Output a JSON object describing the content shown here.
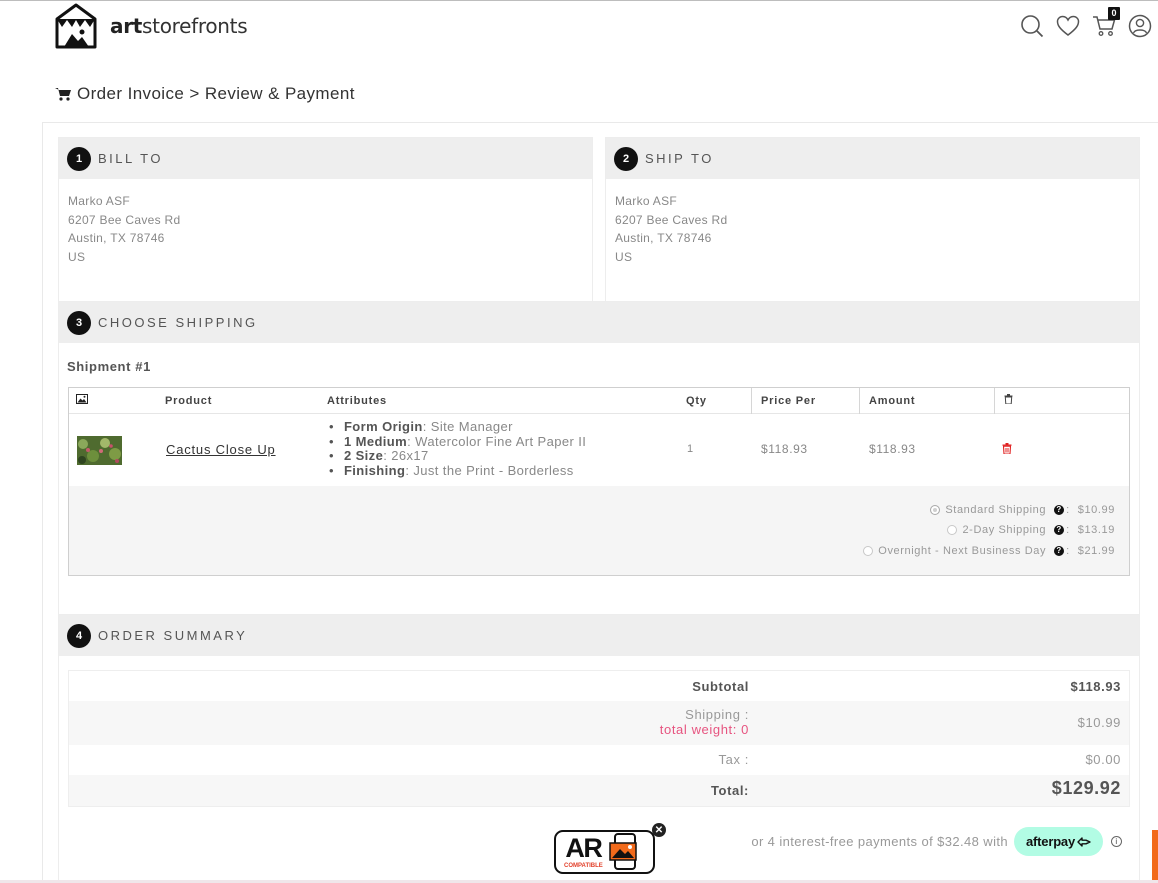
{
  "brand": {
    "name_bold": "art",
    "name_rest": "storefronts"
  },
  "header": {
    "cart_count": "0"
  },
  "breadcrumb": {
    "text": "Order Invoice > Review & Payment"
  },
  "bill_to": {
    "step": "1",
    "title": "BILL TO",
    "lines": [
      "Marko ASF",
      "6207 Bee Caves Rd",
      "Austin, TX 78746",
      "US"
    ]
  },
  "ship_to": {
    "step": "2",
    "title": "SHIP TO",
    "lines": [
      "Marko ASF",
      "6207 Bee Caves Rd",
      "Austin, TX 78746",
      "US"
    ]
  },
  "shipping": {
    "step": "3",
    "title": "CHOOSE SHIPPING",
    "shipment_label": "Shipment #1",
    "columns": {
      "product": "Product",
      "attributes": "Attributes",
      "qty": "Qty",
      "price": "Price Per",
      "amount": "Amount"
    },
    "item": {
      "product": "Cactus Close Up",
      "attributes": [
        {
          "name": "Form Origin",
          "value": ": Site Manager"
        },
        {
          "name": "1 Medium",
          "value": ": Watercolor Fine Art Paper II"
        },
        {
          "name": "2 Size",
          "value": ": 26x17"
        },
        {
          "name": "Finishing",
          "value": ": Just the Print - Borderless"
        }
      ],
      "qty": "1",
      "price": "$118.93",
      "amount": "$118.93"
    },
    "options": [
      {
        "label": "Standard Shipping",
        "price": "$10.99",
        "selected": true
      },
      {
        "label": "2-Day Shipping",
        "price": "$13.19",
        "selected": false
      },
      {
        "label": "Overnight - Next Business Day",
        "price": "$21.99",
        "selected": false
      }
    ]
  },
  "summary": {
    "step": "4",
    "title": "ORDER SUMMARY",
    "subtotal_label": "Subtotal",
    "subtotal": "$118.93",
    "shipping_label": "Shipping :",
    "weight_label": "total weight: 0",
    "shipping": "$10.99",
    "tax_label": "Tax :",
    "tax": "$0.00",
    "total_label": "Total:",
    "total": "$129.92"
  },
  "afterpay": {
    "text": "or 4 interest-free payments of $32.48 with",
    "brand": "afterpay"
  },
  "ar_badge": {
    "text": "AR",
    "sub": "COMPATIBLE"
  },
  "colors": {
    "accent_pink": "#e75480",
    "delete_red": "#e02020",
    "afterpay_mint": "#b2fce4",
    "orange": "#f26a1b"
  }
}
